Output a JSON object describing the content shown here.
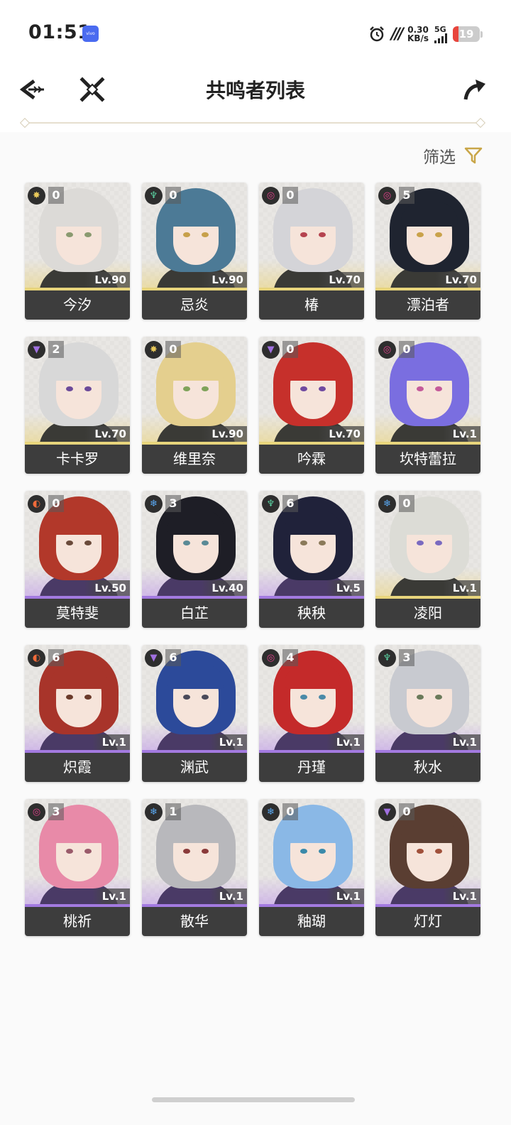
{
  "status_bar": {
    "time": "01:51",
    "brand_badge": "vivo",
    "net_speed_value": "0.30",
    "net_speed_unit": "KB/s",
    "network": "5G",
    "battery": "19"
  },
  "header": {
    "title": "共鸣者列表"
  },
  "filter": {
    "label": "筛选"
  },
  "colors": {
    "gold_accent": "#e8d57c",
    "purple_accent": "#a37ae0",
    "name_plate": "#3d3d3d",
    "filter_icon": "#c9a648"
  },
  "resonators": [
    {
      "name": "今汐",
      "level": "Lv.90",
      "sequence": "0",
      "element": "spectro",
      "rarity": "gold",
      "hair": "#dcdad7",
      "eye": "#8a9a70"
    },
    {
      "name": "忌炎",
      "level": "Lv.90",
      "sequence": "0",
      "element": "aero",
      "rarity": "gold",
      "hair": "#4c7a96",
      "eye": "#c7a04a"
    },
    {
      "name": "椿",
      "level": "Lv.70",
      "sequence": "0",
      "element": "havoc",
      "rarity": "gold",
      "hair": "#d4d4d8",
      "eye": "#b5434f"
    },
    {
      "name": "漂泊者",
      "level": "Lv.70",
      "sequence": "5",
      "element": "havoc",
      "rarity": "gold",
      "hair": "#1f2430",
      "eye": "#c9a24a"
    },
    {
      "name": "卡卡罗",
      "level": "Lv.70",
      "sequence": "2",
      "element": "electro",
      "rarity": "gold",
      "hair": "#d8d8d8",
      "eye": "#6c4a9a"
    },
    {
      "name": "维里奈",
      "level": "Lv.90",
      "sequence": "0",
      "element": "spectro",
      "rarity": "gold",
      "hair": "#e4cf8e",
      "eye": "#7fa35a"
    },
    {
      "name": "吟霖",
      "level": "Lv.70",
      "sequence": "0",
      "element": "electro",
      "rarity": "gold",
      "hair": "#c6302b",
      "eye": "#6f4aa0"
    },
    {
      "name": "坎特蕾拉",
      "level": "Lv.1",
      "sequence": "0",
      "element": "havoc",
      "rarity": "gold",
      "hair": "#7a6ee0",
      "eye": "#c45a9a"
    },
    {
      "name": "莫特斐",
      "level": "Lv.50",
      "sequence": "0",
      "element": "fusion",
      "rarity": "purple",
      "hair": "#b2382a",
      "eye": "#6a4a3a"
    },
    {
      "name": "白芷",
      "level": "Lv.40",
      "sequence": "3",
      "element": "glacio",
      "rarity": "purple",
      "hair": "#1e1e26",
      "eye": "#5a8a96"
    },
    {
      "name": "秧秧",
      "level": "Lv.5",
      "sequence": "6",
      "element": "aero",
      "rarity": "purple",
      "hair": "#20223a",
      "eye": "#8a7a5a"
    },
    {
      "name": "凌阳",
      "level": "Lv.1",
      "sequence": "0",
      "element": "glacio",
      "rarity": "gold",
      "hair": "#dcdcd6",
      "eye": "#7a6ac0"
    },
    {
      "name": "炽霞",
      "level": "Lv.1",
      "sequence": "6",
      "element": "fusion",
      "rarity": "purple",
      "hair": "#a8342a",
      "eye": "#6a3a2a"
    },
    {
      "name": "渊武",
      "level": "Lv.1",
      "sequence": "6",
      "element": "electro",
      "rarity": "purple",
      "hair": "#2c4a9a",
      "eye": "#4a4a5a"
    },
    {
      "name": "丹瑾",
      "level": "Lv.1",
      "sequence": "4",
      "element": "havoc",
      "rarity": "purple",
      "hair": "#c42a2a",
      "eye": "#4a8aa8"
    },
    {
      "name": "秋水",
      "level": "Lv.1",
      "sequence": "3",
      "element": "aero",
      "rarity": "purple",
      "hair": "#c8cad0",
      "eye": "#6a7a5a"
    },
    {
      "name": "桃祈",
      "level": "Lv.1",
      "sequence": "3",
      "element": "havoc",
      "rarity": "purple",
      "hair": "#e88aa8",
      "eye": "#9a5a6a"
    },
    {
      "name": "散华",
      "level": "Lv.1",
      "sequence": "1",
      "element": "glacio",
      "rarity": "purple",
      "hair": "#b8b8bc",
      "eye": "#8a3a3a"
    },
    {
      "name": "釉瑚",
      "level": "Lv.1",
      "sequence": "0",
      "element": "glacio",
      "rarity": "purple",
      "hair": "#8ab8e6",
      "eye": "#3a8aaa"
    },
    {
      "name": "灯灯",
      "level": "Lv.1",
      "sequence": "0",
      "element": "electro",
      "rarity": "purple",
      "hair": "#5a3e32",
      "eye": "#a0503a"
    }
  ],
  "element_icons": {
    "spectro": {
      "glyph": "✸",
      "color": "#e8c85a"
    },
    "aero": {
      "glyph": "♆",
      "color": "#5ad0a0"
    },
    "havoc": {
      "glyph": "◎",
      "color": "#e0408a"
    },
    "electro": {
      "glyph": "▼",
      "color": "#a070e0"
    },
    "fusion": {
      "glyph": "◐",
      "color": "#f06a3a"
    },
    "glacio": {
      "glyph": "❄",
      "color": "#5aa8f0"
    }
  }
}
